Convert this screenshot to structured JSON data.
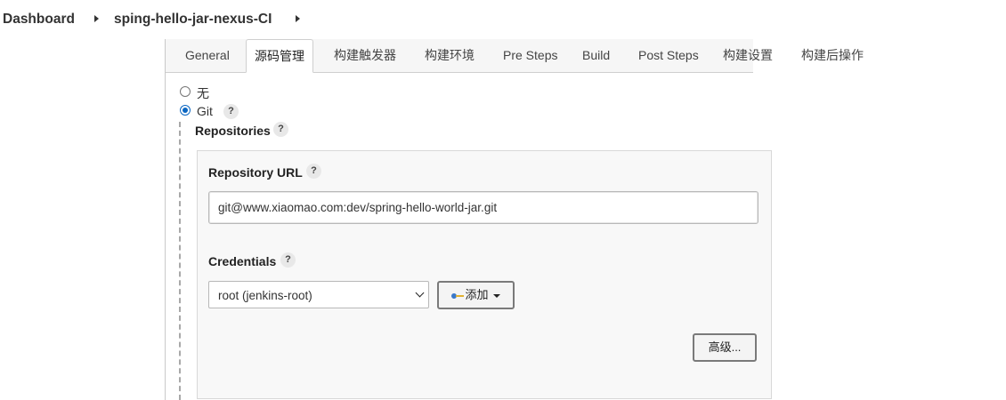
{
  "breadcrumb": {
    "items": [
      "Dashboard",
      "sping-hello-jar-nexus-CI"
    ]
  },
  "tabs": [
    {
      "label": "General",
      "active": false
    },
    {
      "label": "源码管理",
      "active": true
    },
    {
      "label": "构建触发器",
      "active": false
    },
    {
      "label": "构建环境",
      "active": false
    },
    {
      "label": "Pre Steps",
      "active": false
    },
    {
      "label": "Build",
      "active": false
    },
    {
      "label": "Post Steps",
      "active": false
    },
    {
      "label": "构建设置",
      "active": false
    },
    {
      "label": "构建后操作",
      "active": false
    }
  ],
  "scm": {
    "option_none": "无",
    "option_git": "Git",
    "selected": "Git",
    "help_glyph": "?",
    "repositories_label": "Repositories",
    "repository_url_label": "Repository URL",
    "repository_url_value": "git@www.xiaomao.com:dev/spring-hello-world-jar.git",
    "credentials_label": "Credentials",
    "credentials_selected": "root (jenkins-root)",
    "add_button_label": "添加",
    "advanced_button_label": "高级..."
  }
}
